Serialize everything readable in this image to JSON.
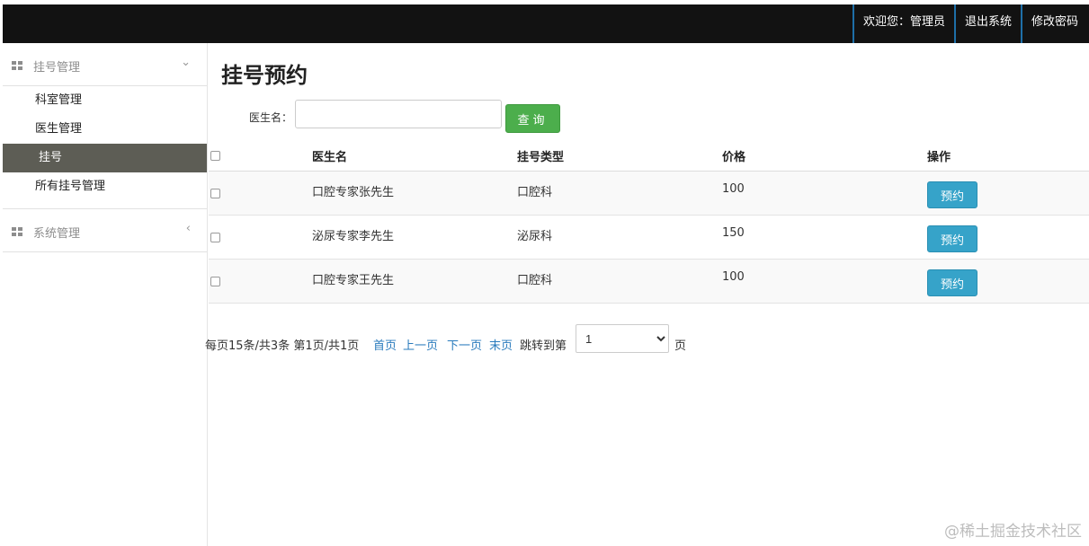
{
  "topbar": {
    "welcome": "欢迎您：管理员",
    "logout": "退出系统",
    "change_password": "修改密码"
  },
  "sidebar": {
    "group1": {
      "label": "挂号管理",
      "icon": "grid-icon",
      "chevron": "chevron-down-icon"
    },
    "items": [
      {
        "label": "科室管理",
        "active": false
      },
      {
        "label": "医生管理",
        "active": false
      },
      {
        "label": "挂号",
        "active": true
      },
      {
        "label": "所有挂号管理",
        "active": false
      }
    ],
    "group2": {
      "label": "系统管理",
      "icon": "grid-icon",
      "chevron": "chevron-left-icon"
    }
  },
  "main": {
    "title": "挂号预约",
    "search": {
      "label": "医生名：",
      "value": "",
      "button": "查询"
    },
    "table": {
      "headers": [
        "医生名",
        "挂号类型",
        "价格",
        "操作"
      ],
      "rows": [
        {
          "doctor": "口腔专家张先生",
          "type": "口腔科",
          "price": "100",
          "action": "预约"
        },
        {
          "doctor": "泌尿专家李先生",
          "type": "泌尿科",
          "price": "150",
          "action": "预约"
        },
        {
          "doctor": "口腔专家王先生",
          "type": "口腔科",
          "price": "100",
          "action": "预约"
        }
      ]
    },
    "pager": {
      "summary": "每页15条/共3条 第1页/共1页",
      "first": "首页",
      "prev": "上一页",
      "next": "下一页",
      "last": "末页",
      "jump_label": "跳转到第",
      "page_value": "1",
      "page_suffix": "页"
    }
  },
  "watermark": "@稀土掘金技术社区",
  "colors": {
    "topbar_bg": "#121212",
    "active_menu_bg": "#5d5d55",
    "search_button": "#4cae4c",
    "book_button": "#36a3c9",
    "link": "#2a7bbd"
  }
}
